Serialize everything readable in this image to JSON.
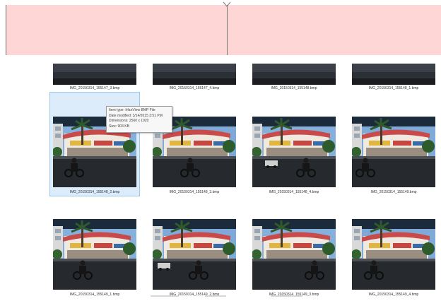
{
  "explorer": {
    "rows": [
      {
        "partial": true,
        "files": [
          {
            "name": "IMG_20150314_155147_3.bmp"
          },
          {
            "name": "IMG_20150314_155147_4.bmp"
          },
          {
            "name": "IMG_20150314_155148.bmp"
          },
          {
            "name": "IMG_20150314_155148_1.bmp"
          }
        ]
      },
      {
        "partial": false,
        "files": [
          {
            "name": "IMG_20150314_155148_2.bmp",
            "selected": true
          },
          {
            "name": "IMG_20150314_155148_3.bmp"
          },
          {
            "name": "IMG_20150314_155148_4.bmp"
          },
          {
            "name": "IMG_20150314_155149.bmp"
          }
        ]
      },
      {
        "partial": false,
        "files": [
          {
            "name": "IMG_20150314_155149_1.bmp"
          },
          {
            "name": "IMG_20150314_155149_2.bmp"
          },
          {
            "name": "IMG_20150314_155149_3.bmp"
          },
          {
            "name": "IMG_20150314_155149_4.bmp"
          }
        ]
      }
    ],
    "tooltip": {
      "item_type": "Item type: IrfanView BMP File",
      "date_modified": "Date modified: 3/14/2015 3:51 PM",
      "dimensions": "Dimensions: 2560 x 1920",
      "size": "Size: 903 KB"
    }
  },
  "colors": {
    "banner": "#ffd6d6",
    "selection_fill": "#dcecfb",
    "selection_border": "#99c8ef"
  }
}
